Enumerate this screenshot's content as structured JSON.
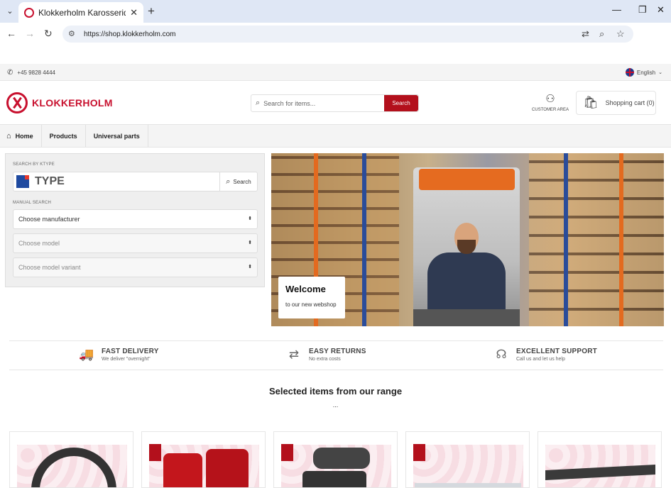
{
  "browser": {
    "tab_title": "Klokkerholm Karosseridele - Fa",
    "url": "https://shop.klokkerholm.com",
    "icons": [
      "tab-list-icon",
      "close-icon",
      "new-tab-icon",
      "minimize-icon",
      "restore-icon",
      "close-window-icon",
      "back-icon",
      "forward-icon",
      "reload-icon",
      "site-info-icon",
      "translate-icon",
      "zoom-icon",
      "bookmark-star-icon"
    ]
  },
  "topstrip": {
    "phone": "+45 9828 4444",
    "language": "English"
  },
  "header": {
    "logo_text": "KLOKKERHOLM",
    "search_placeholder": "Search for items...",
    "search_button": "Search",
    "customer_area": "CUSTOMER AREA",
    "cart_label": "Shopping cart (0)"
  },
  "nav": {
    "items": [
      {
        "label": "Home"
      },
      {
        "label": "Products"
      },
      {
        "label": "Universal parts"
      }
    ]
  },
  "search_panel": {
    "ktype_label": "SEARCH BY KTYPE",
    "ktype_placeholder": "TYPE",
    "ktype_button": "Search",
    "manual_label": "MANUAL SEARCH",
    "selects": [
      {
        "value": "Choose manufacturer",
        "enabled": true
      },
      {
        "value": "Choose model",
        "enabled": false
      },
      {
        "value": "Choose model variant",
        "enabled": false
      }
    ]
  },
  "hero": {
    "title": "Welcome",
    "subtitle": "to our new webshop"
  },
  "features": [
    {
      "title": "FAST DELIVERY",
      "subtitle": "We deliver \"overnight\"",
      "icon": "truck-icon"
    },
    {
      "title": "EASY RETURNS",
      "subtitle": "No extra costs",
      "icon": "returns-arrows-icon"
    },
    {
      "title": "EXCELLENT SUPPORT",
      "subtitle": "Call us and let us help",
      "icon": "support-headset-icon"
    }
  ],
  "range": {
    "title": "Selected items from our range",
    "dots": "..."
  },
  "colors": {
    "brand_red": "#c8102e",
    "button_red": "#b3101c"
  }
}
